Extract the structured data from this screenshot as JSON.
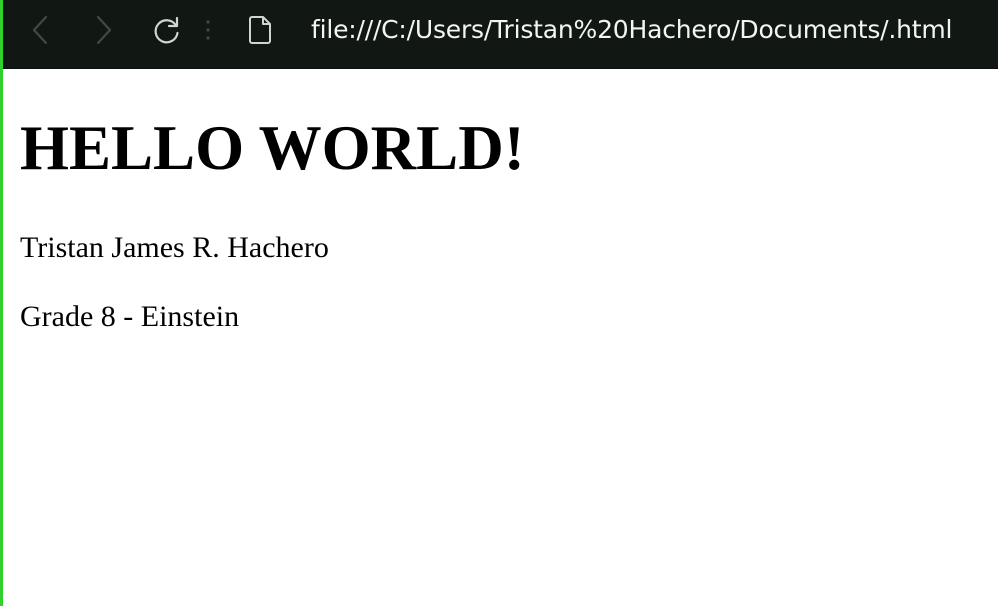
{
  "browser": {
    "address_bar": {
      "url": "file:///C:/Users/Tristan%20Hachero/Documents/.html"
    },
    "icons": {
      "back": "chevron-left-icon",
      "forward": "chevron-right-icon",
      "reload": "reload-icon",
      "menu": "vertical-dots-icon",
      "page": "file-page-icon"
    },
    "colors": {
      "toolbar_background": "#111814",
      "icon_dim": "#3f4a43",
      "icon_active": "#cfd6d1",
      "url_text": "#f2f5f3",
      "window_accent_border": "#2fd12f"
    }
  },
  "page": {
    "heading": "HELLO WORLD!",
    "name_line": "Tristan James R. Hachero",
    "grade_line": "Grade 8 - Einstein"
  }
}
